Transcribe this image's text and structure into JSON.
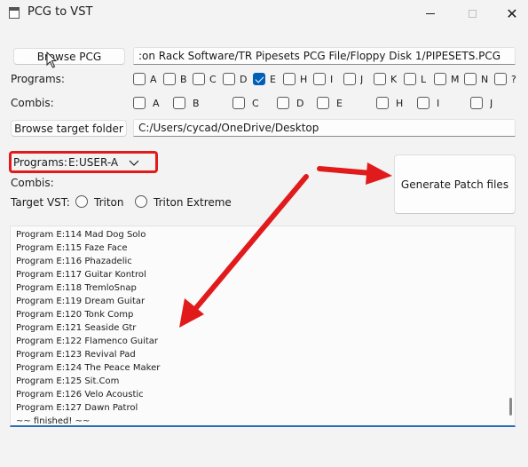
{
  "window": {
    "title": "PCG to VST"
  },
  "browse_pcg": {
    "button_label": "Browse PCG",
    "path_value": ":on Rack Software/TR Pipesets PCG File/Floppy Disk 1/PIPESETS.PCG"
  },
  "programs_row": {
    "label": "Programs:",
    "checkboxes": [
      {
        "label": "A",
        "checked": false
      },
      {
        "label": "B",
        "checked": false
      },
      {
        "label": "C",
        "checked": false
      },
      {
        "label": "D",
        "checked": false
      },
      {
        "label": "E",
        "checked": true
      },
      {
        "label": "H",
        "checked": false
      },
      {
        "label": "I",
        "checked": false
      },
      {
        "label": "J",
        "checked": false
      },
      {
        "label": "K",
        "checked": false
      },
      {
        "label": "L",
        "checked": false
      },
      {
        "label": "M",
        "checked": false
      },
      {
        "label": "N",
        "checked": false
      },
      {
        "label": "?",
        "checked": false
      }
    ]
  },
  "combis_row": {
    "label": "Combis:",
    "checkboxes": [
      {
        "label": "A",
        "checked": false
      },
      {
        "label": "B",
        "checked": false
      },
      {
        "label": "C",
        "checked": false
      },
      {
        "label": "D",
        "checked": false
      },
      {
        "label": "E",
        "checked": false
      },
      {
        "label": "H",
        "checked": false
      },
      {
        "label": "I",
        "checked": false
      },
      {
        "label": "J",
        "checked": false
      }
    ]
  },
  "target_folder": {
    "button_label": "Browse target folder",
    "path_value": "C:/Users/cycad/OneDrive/Desktop"
  },
  "programs_select": {
    "label": "Programs:",
    "bank": "E:",
    "value": "USER-A",
    "chevron": "chevron-down-icon"
  },
  "combis_select": {
    "label": "Combis:"
  },
  "target_vst": {
    "label": "Target VST:",
    "options": [
      {
        "label": "Triton",
        "checked": false
      },
      {
        "label": "Triton Extreme",
        "checked": true
      }
    ]
  },
  "generate_button": {
    "label": "Generate Patch files"
  },
  "log": {
    "lines": [
      "Program E:114 Mad Dog Solo",
      "Program E:115 Faze Face",
      "Program E:116 Phazadelic",
      "Program E:117 Guitar Kontrol",
      "Program E:118 TremloSnap",
      "Program E:119 Dream Guitar",
      "Program E:120 Tonk Comp",
      "Program E:121 Seaside Gtr",
      "Program E:122 Flamenco Guitar",
      "Program E:123 Revival Pad",
      "Program E:124 The Peace Maker",
      "Program E:125 Sit.Com",
      "Program E:126 Velo Acoustic",
      "Program E:127 Dawn Patrol",
      "~~ finished! ~~"
    ]
  },
  "colors": {
    "accent": "#005fb8",
    "highlight_box": "#e11b1b",
    "annotation_arrow": "#e11b1b"
  }
}
